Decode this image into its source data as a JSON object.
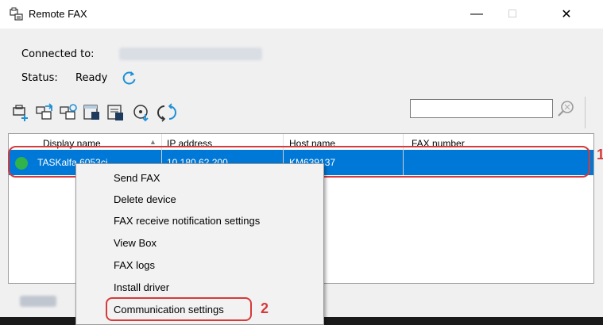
{
  "window": {
    "title": "Remote FAX",
    "app_icon": "remote-fax-icon",
    "controls": {
      "minimize": "—",
      "maximize": "□",
      "close": "✕"
    }
  },
  "info": {
    "connected_label": "Connected to:",
    "status_label": "Status:",
    "status_value": "Ready",
    "refresh_icon": "refresh-icon"
  },
  "toolbar": {
    "icons": [
      "add-device-icon",
      "send-fax-icon",
      "fax-receive-icon",
      "fax-logs-icon",
      "communication-settings-icon",
      "install-driver-icon",
      "refresh-all-icon"
    ],
    "search_placeholder": "",
    "search_icon": "search-icon"
  },
  "table": {
    "columns": [
      "Display name",
      "IP address",
      "Host name",
      "FAX number"
    ],
    "rows": [
      {
        "status": "ready",
        "display_name": "TASKalfa 6053ci",
        "ip": "10.180.62.200",
        "host": "KM639137",
        "fax_number": ""
      }
    ]
  },
  "context_menu": {
    "items": [
      "Send FAX",
      "Delete device",
      "FAX receive notification settings",
      "View Box",
      "FAX logs",
      "Install driver",
      "Communication settings"
    ],
    "highlighted": "Communication settings"
  },
  "annotations": {
    "marker_1": "1",
    "marker_2": "2",
    "accent": "#d63a3a"
  },
  "colors": {
    "selection": "#0078d7",
    "status_ready": "#2fb34a",
    "refresh": "#1e90d6"
  }
}
